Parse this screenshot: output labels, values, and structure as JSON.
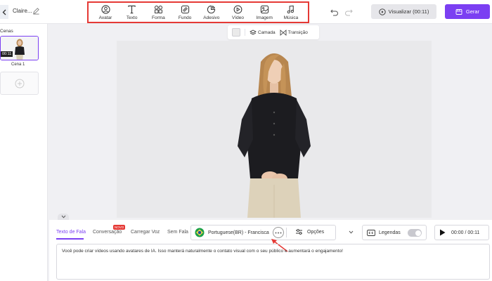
{
  "header": {
    "project_name": "Claire...",
    "tools": [
      {
        "label": "Avatar",
        "icon": "avatar-icon"
      },
      {
        "label": "Texto",
        "icon": "text-icon"
      },
      {
        "label": "Forma",
        "icon": "shapes-icon"
      },
      {
        "label": "Fundo",
        "icon": "background-icon"
      },
      {
        "label": "Adesivo",
        "icon": "sticker-icon"
      },
      {
        "label": "Vídeo",
        "icon": "video-icon"
      },
      {
        "label": "Imagem",
        "icon": "image-icon"
      },
      {
        "label": "Música",
        "icon": "music-icon"
      }
    ],
    "preview_label": "Visualizar (00:11)",
    "generate_label": "Gerar"
  },
  "sidebar": {
    "title": "Cenas",
    "scenes": [
      {
        "label": "Cena 1",
        "duration": "00:11"
      }
    ]
  },
  "canvas_toolbar": {
    "layer_label": "Camada",
    "transition_label": "Transição"
  },
  "bottom": {
    "tabs": [
      {
        "label": "Texto de Fala",
        "active": true
      },
      {
        "label": "Conversação",
        "badge": "NOVO"
      },
      {
        "label": "Carregar Voz"
      },
      {
        "label": "Sem Fala"
      }
    ],
    "voice": "Portuguese(BR) - Francisca",
    "options_label": "Opções",
    "subtitles_label": "Legendas",
    "subtitles_enabled": false,
    "time": "00:00 / 00:11",
    "script_text": "Você pode criar vídeos usando avatares de IA. Isso manterá naturalmente o contato visual com o seu público e aumentará o engajamento!"
  },
  "colors": {
    "accent": "#7b3ff2",
    "highlight": "#e53935"
  }
}
